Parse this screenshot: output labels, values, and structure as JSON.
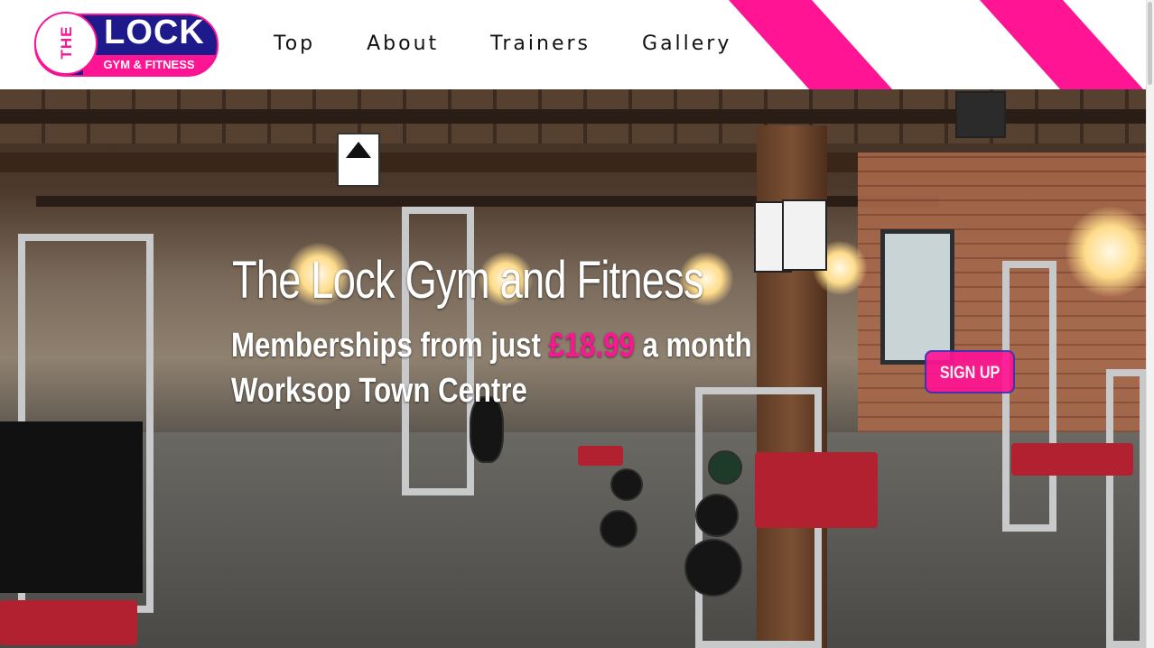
{
  "logo": {
    "the": "THE",
    "lock": "LOCK",
    "subtitle": "GYM & FITNESS",
    "colors": {
      "pink": "#ff1493",
      "navy": "#1e1a8c"
    }
  },
  "nav": {
    "items": [
      "Top",
      "About",
      "Trainers",
      "Gallery"
    ]
  },
  "hero": {
    "title": "The Lock Gym and Fitness",
    "membership_prefix": "Memberships from just ",
    "price": "£18.99",
    "membership_suffix": " a month",
    "location": "Worksop Town Centre",
    "signup_label": "SIGN UP"
  }
}
